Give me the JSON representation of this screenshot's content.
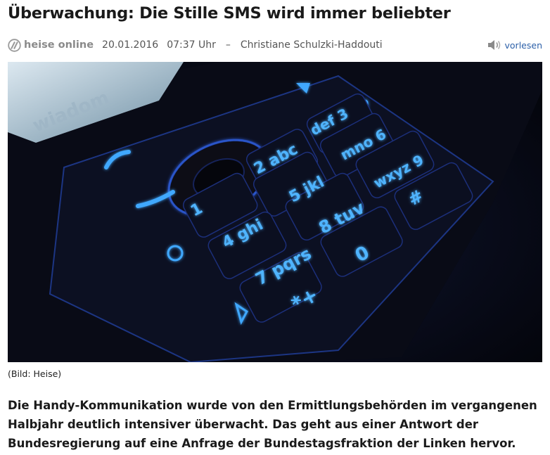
{
  "article": {
    "title": "Überwachung: Die Stille SMS wird immer beliebter",
    "source": "heise online",
    "date": "20.01.2016",
    "time": "07:37 Uhr",
    "dash": "–",
    "author": "Christiane Schulzki-Haddouti",
    "read_aloud_label": "vorlesen",
    "image_caption": "(Bild: Heise)",
    "lead": "Die Handy-Kommunikation wurde von den Ermittlungsbehörden im vergangenen Halbjahr deutlich intensiver überwacht. Das geht aus einer Antwort der Bundesregierung auf eine Anfrage der Bundestagsfraktion der Linken hervor."
  },
  "photo_keys": {
    "screen_text": "wiadom",
    "keys": [
      "1",
      "2 abc",
      "def 3",
      "4 ghi",
      "5 jkl",
      "mno 6",
      "7 pqrs",
      "8 tuv",
      "wxyz 9",
      "*+",
      "0",
      "#"
    ]
  },
  "icons": [
    "heise-logo-icon",
    "speaker-icon"
  ],
  "colors": {
    "link": "#2b5fa8",
    "key_glow": "#3fa8ff",
    "photo_bg": "#06070f"
  }
}
